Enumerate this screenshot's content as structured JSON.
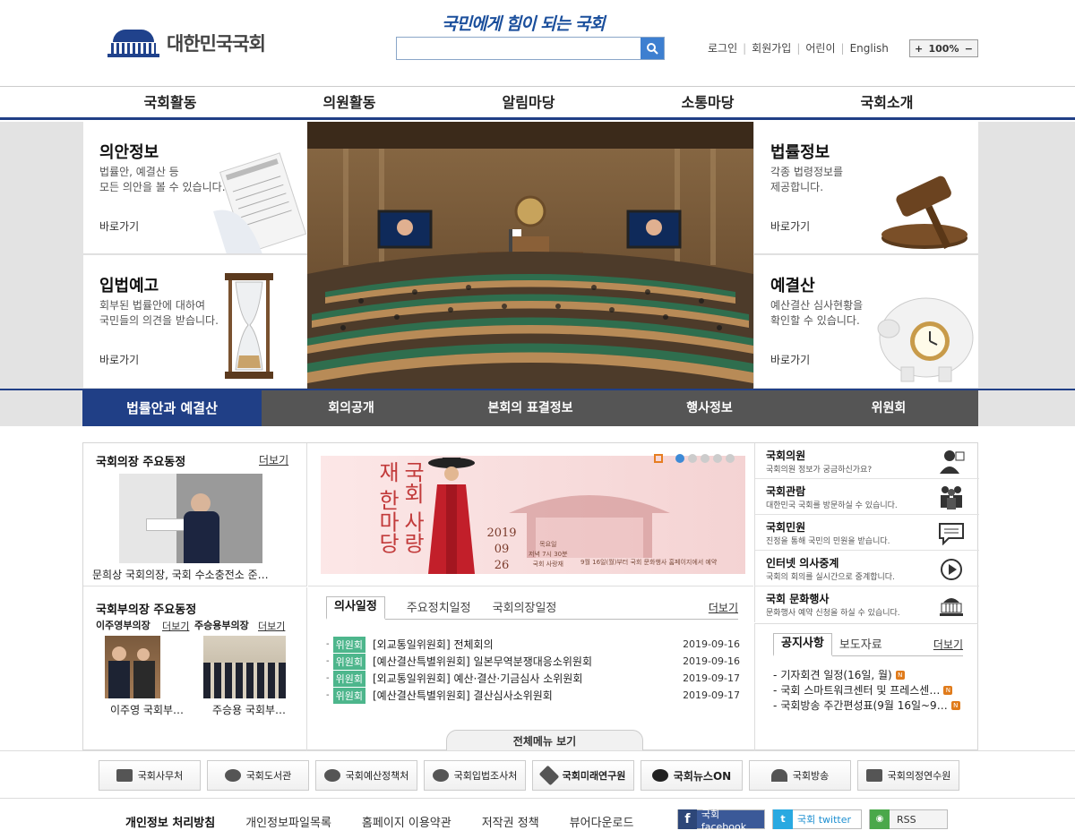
{
  "header": {
    "site_name": "대한민국국회",
    "slogan": "국민에게 힘이 되는 국회",
    "search_placeholder": "",
    "util_links": [
      "로그인",
      "회원가입",
      "어린이",
      "English"
    ],
    "zoom": {
      "minus": "−",
      "value": "100%",
      "plus": "+"
    }
  },
  "gnb": [
    "국회활동",
    "의원활동",
    "알림마당",
    "소통마당",
    "국회소개"
  ],
  "visual": {
    "boxes": [
      {
        "title": "의안정보",
        "desc": "법률안, 예결산 등\n모든 의안을 볼 수 있습니다.",
        "go": "바로가기"
      },
      {
        "title": "법률정보",
        "desc": "각종 법령정보를\n제공합니다.",
        "go": "바로가기"
      },
      {
        "title": "입법예고",
        "desc": "회부된 법률안에 대하여\n국민들의 의견을 받습니다.",
        "go": "바로가기"
      },
      {
        "title": "예결산",
        "desc": "예산결산 심사현황을\n확인할 수 있습니다.",
        "go": "바로가기"
      }
    ]
  },
  "tabs": [
    "법률안과 예결산",
    "회의공개",
    "본회의 표결정보",
    "행사정보",
    "위원회"
  ],
  "speaker": {
    "title": "국회의장 주요동정",
    "more": "더보기",
    "caption": "문희상 국회의장, 국회 수소충전소 준…"
  },
  "vice": {
    "title": "국회부의장 주요동정",
    "items": [
      {
        "name": "이주영부의장",
        "more": "더보기",
        "caption": "이주영 국회부…"
      },
      {
        "name": "주승용부의장",
        "more": "더보기",
        "caption": "주승용 국회부…"
      }
    ]
  },
  "banner": {
    "chars": "국회 사랑재 한마당",
    "year": "2019",
    "month": "09",
    "day": "26",
    "info1": "목요일",
    "info2": "저녁 7시 30분",
    "info3": "국회 사랑재",
    "notice": "9월 16일(월)부터 국회 문화행사 홈페이지에서 예약"
  },
  "schedule": {
    "tabs": [
      "의사일정",
      "주요정치일정",
      "국회의장일정"
    ],
    "more": "더보기",
    "rows": [
      {
        "tag": "위원회",
        "text": "[외교통일위원회] 전체회의",
        "date": "2019-09-16"
      },
      {
        "tag": "위원회",
        "text": "[예산결산특별위원회] 일본무역분쟁대응소위원회",
        "date": "2019-09-16"
      },
      {
        "tag": "위원회",
        "text": "[외교통일위원회] 예산·결산·기금심사 소위원회",
        "date": "2019-09-17"
      },
      {
        "tag": "위원회",
        "text": "[예산결산특별위원회] 결산심사소위원회",
        "date": "2019-09-17"
      }
    ]
  },
  "quick": [
    {
      "title": "국회의원",
      "desc": "국회의원 정보가 궁금하신가요?"
    },
    {
      "title": "국회관람",
      "desc": "대한민국 국회를 방문하실 수 있습니다."
    },
    {
      "title": "국회민원",
      "desc": "진정을 통해 국민의 민원을 받습니다."
    },
    {
      "title": "인터넷 의사중계",
      "desc": "국회의 회의를 실시간으로 중계합니다."
    },
    {
      "title": "국회 문화행사",
      "desc": "문화행사 예약 신청을 하실 수 있습니다."
    }
  ],
  "notice": {
    "tabs": [
      "공지사항",
      "보도자료"
    ],
    "more": "더보기",
    "items": [
      "기자회견 일정(16일, 월)",
      "국회 스마트워크센터 및 프레스센…",
      "국회방송 주간편성표(9월 16일~9…"
    ]
  },
  "allmenu": "전체메뉴 보기",
  "family": [
    "국회사무처",
    "국회도서관",
    "국회예산정책처",
    "국회입법조사처",
    "국회미래연구원",
    "국회뉴스ON",
    "국회방송",
    "국회의정연수원"
  ],
  "footer": {
    "links": [
      "개인정보 처리방침",
      "개인정보파일목록",
      "홈페이지 이용약관",
      "저작권 정책",
      "뷰어다운로드"
    ],
    "sns": [
      "국회 facebook",
      "국회 twitter",
      "RSS"
    ]
  },
  "colors": {
    "brand": "#203f86",
    "accent": "#3d7fd0",
    "tag": "#4db68c",
    "new": "#e07b1b"
  }
}
